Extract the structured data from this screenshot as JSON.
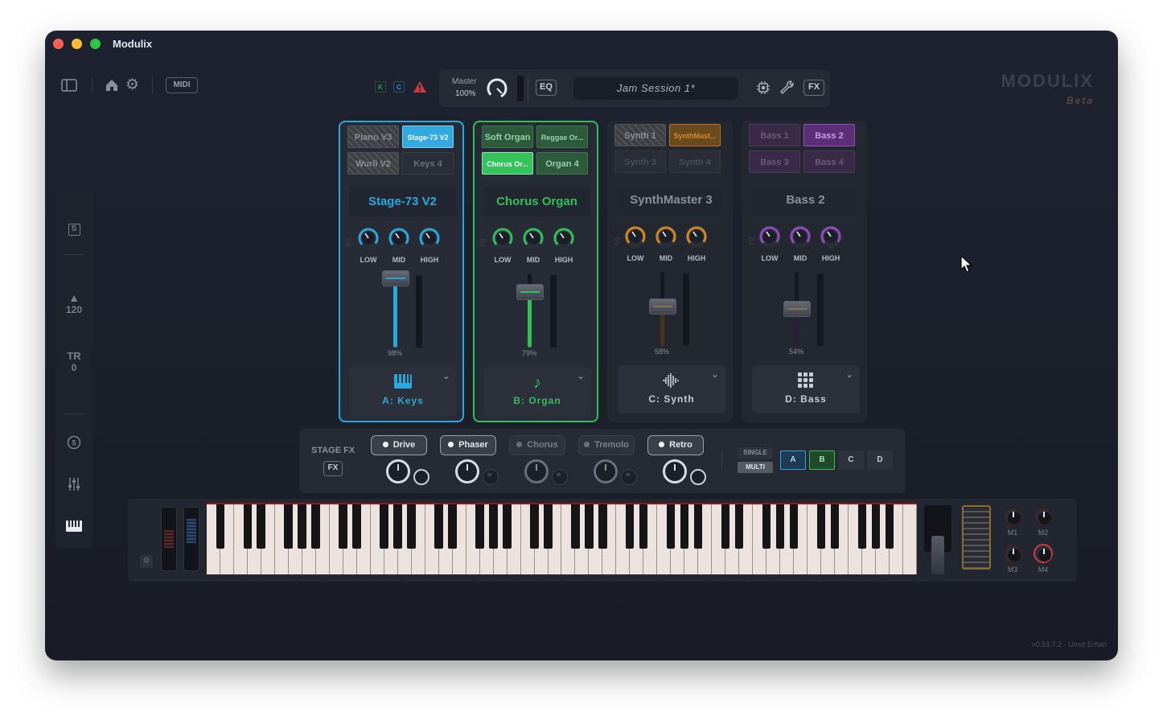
{
  "window": {
    "title": "Modulix"
  },
  "toolbar": {
    "midi_label": "MIDI",
    "k": "K",
    "c": "C"
  },
  "master": {
    "label": "Master",
    "value": "100%"
  },
  "topbar": {
    "eq_label": "EQ",
    "session": "Jam Session 1*",
    "fx_label": "FX"
  },
  "brand": {
    "name": "MODULIX",
    "tag": "Beta"
  },
  "sidebar": {
    "s_label": "S",
    "tempo": "120",
    "tr_label": "TR",
    "tr_value": "0"
  },
  "strips": [
    {
      "slots": [
        "Piano V3",
        "Stage-73 V2",
        "Wurli V2",
        "Keys 4"
      ],
      "name": "Stage-73 V2",
      "knobs": [
        "LOW",
        "MID",
        "HIGH"
      ],
      "level": "98%",
      "category": "A: Keys",
      "accent": "#29a8e0",
      "level_value": 0.98
    },
    {
      "slots": [
        "Soft Organ",
        "Reggae Or...",
        "Chorus Or...",
        "Organ 4"
      ],
      "name": "Chorus Organ",
      "knobs": [
        "LOW",
        "MID",
        "HIGH"
      ],
      "level": "79%",
      "category": "B: Organ",
      "accent": "#31c057",
      "level_value": 0.79
    },
    {
      "slots": [
        "Synth 1",
        "SynthMast...",
        "Synth 3",
        "Synth 4"
      ],
      "name": "SynthMaster 3",
      "knobs": [
        "LOW",
        "MID",
        "HIGH"
      ],
      "level": "58%",
      "category": "C: Synth",
      "accent": "#f0961e",
      "level_value": 0.58
    },
    {
      "slots": [
        "Bass 1",
        "Bass 2",
        "Bass 3",
        "Bass 4"
      ],
      "name": "Bass 2",
      "knobs": [
        "LOW",
        "MID",
        "HIGH"
      ],
      "level": "54%",
      "category": "D: Bass",
      "accent": "#a24fd8",
      "level_value": 0.54
    }
  ],
  "stage_fx": {
    "label": "STAGE FX",
    "fx_button": "FX",
    "effects": [
      {
        "name": "Drive",
        "on": true
      },
      {
        "name": "Phaser",
        "on": true
      },
      {
        "name": "Chorus",
        "on": false
      },
      {
        "name": "Tremolo",
        "on": false
      },
      {
        "name": "Retro",
        "on": true
      }
    ]
  },
  "mode": {
    "single": "SINGLE",
    "multi": "MULTI",
    "parts": [
      "A",
      "B",
      "C",
      "D"
    ]
  },
  "macros": [
    "M1",
    "M2",
    "M3",
    "M4"
  ],
  "version": "v0.53.7.2 - Umut Erhan"
}
